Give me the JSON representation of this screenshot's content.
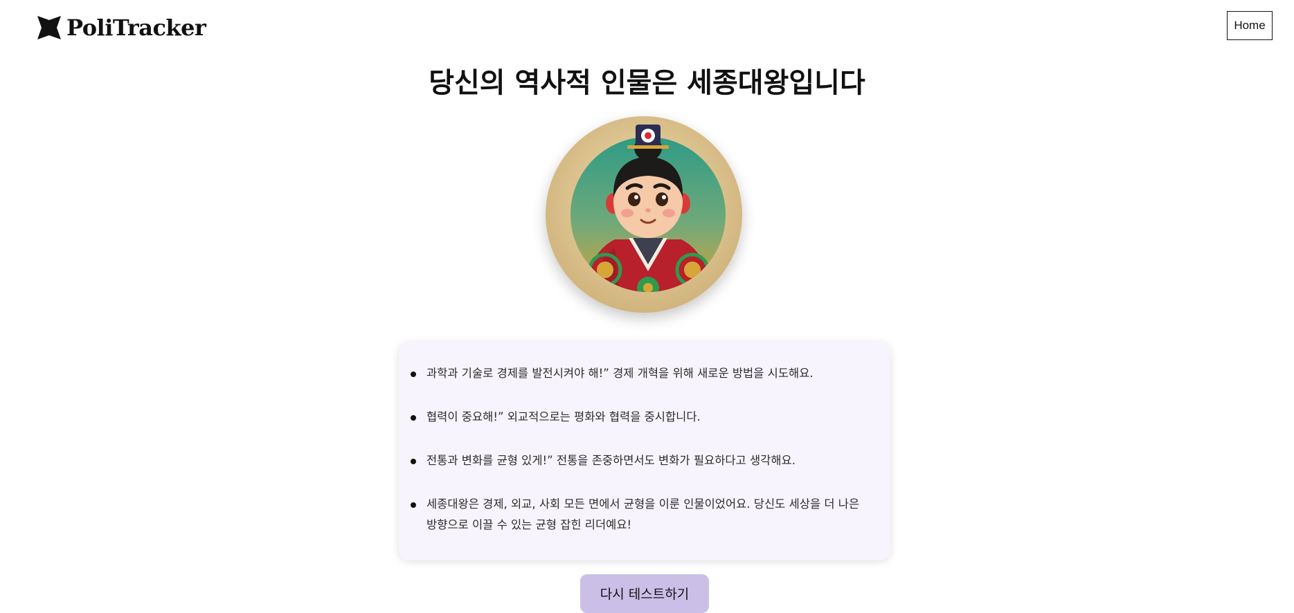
{
  "header": {
    "logo_text": "PoliTracker",
    "logo_icon": "star-badge-icon",
    "home_label": "Home"
  },
  "result": {
    "title": "당신의 역사적 인물은 세종대왕입니다",
    "avatar_icon": "king-sejong-portrait"
  },
  "traits": [
    "과학과 기술로 경제를 발전시켜야 해!” 경제 개혁을 위해 새로운 방법을 시도해요.",
    "협력이 중요해!” 외교적으로는 평화와 협력을 중시합니다.",
    "전통과 변화를 균형 있게!” 전통을 존중하면서도 변화가 필요하다고 생각해요.",
    "세종대왕은 경제, 외교, 사회 모든 면에서 균형을 이룬 인물이었어요. 당신도 세상을 더 나은 방향으로 이끌 수 있는 균형 잡힌 리더예요!"
  ],
  "actions": {
    "retry_label": "다시 테스트하기"
  },
  "colors": {
    "card_background": "#f7f4fd",
    "retry_button": "#cbbfe8",
    "text": "#111111"
  }
}
